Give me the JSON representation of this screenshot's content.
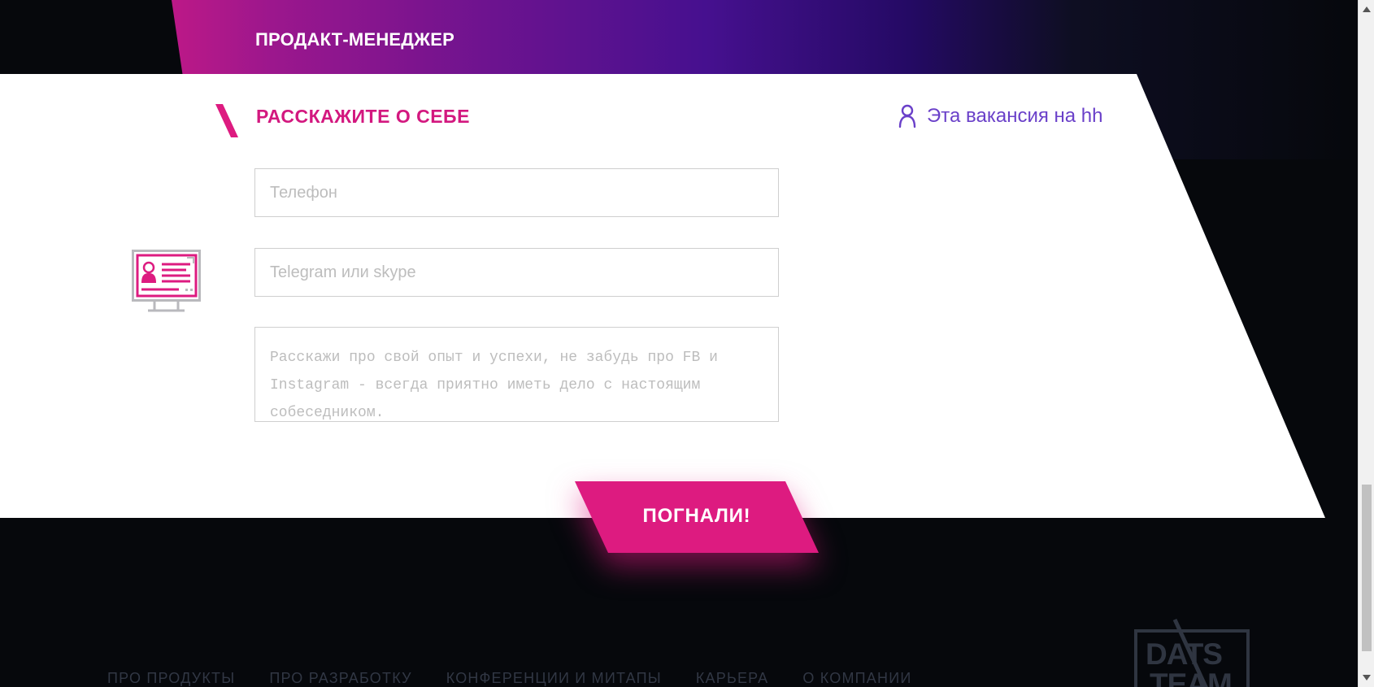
{
  "job": {
    "title": "ПРОДАКТ-МЕНЕДЖЕР"
  },
  "form": {
    "heading": "РАССКАЖИТЕ О СЕБЕ",
    "hh_link": "Эта вакансия на hh",
    "fields": {
      "phone": {
        "value": "",
        "placeholder": "Телефон"
      },
      "contact": {
        "value": "",
        "placeholder": "Telegram или skype"
      },
      "experience": {
        "value": "",
        "placeholder": "Расскажи про свой опыт и успехи, не забудь про FB и Instagram - всегда приятно иметь дело с настоящим собеседником."
      }
    },
    "submit_label": "ПОГНАЛИ!"
  },
  "footer": {
    "nav": [
      "ПРО ПРОДУКТЫ",
      "ПРО РАЗРАБОТКУ",
      "КОНФЕРЕНЦИИ И МИТАПЫ",
      "КАРЬЕРА",
      "О КОМПАНИИ"
    ],
    "logo_text": "DATS TEAM"
  },
  "icons": {
    "section_marker": "slash-icon",
    "hh_link": "user-outline-icon",
    "form_illustration": "computer-profile-icon",
    "footer_logo": "dats-team-logo"
  },
  "colors": {
    "brand_pink": "#dd1b80",
    "heading_pink": "#d3187f",
    "hh_purple": "#6a40c9",
    "page_background": "#06080c",
    "panel_background": "#ffffff"
  }
}
